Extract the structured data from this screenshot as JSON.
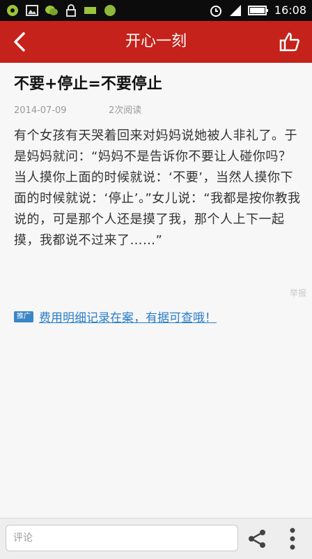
{
  "status_bar": {
    "time": "16:08"
  },
  "header": {
    "title": "开心一刻"
  },
  "article": {
    "title": "不要+停止=不要停止",
    "date": "2014-07-09",
    "reads": "2次阅读",
    "body": "有个女孩有天哭着回来对妈妈说她被人非礼了。于是妈妈就问：“妈妈不是告诉你不要让人碰你吗？当人摸你上面的时候就说：‘不要’，当然人摸你下面的时候就说：‘停止’。”女儿说：“我都是按你教我说的，可是那个人还是摸了我，那个人上下一起摸，我都说不过来了……”",
    "report_label": "举报"
  },
  "ad": {
    "badge": "推广",
    "link_text": "费用明细记录在案，有据可查哦！"
  },
  "bottom_bar": {
    "comment_placeholder": "评论"
  },
  "colors": {
    "header_bg": "#c4221a",
    "link": "#2a7ec7",
    "ad_badge": "#3a86c8"
  },
  "icons": [
    "back-arrow-icon",
    "thumbs-up-icon",
    "share-icon",
    "more-vertical-icon"
  ]
}
